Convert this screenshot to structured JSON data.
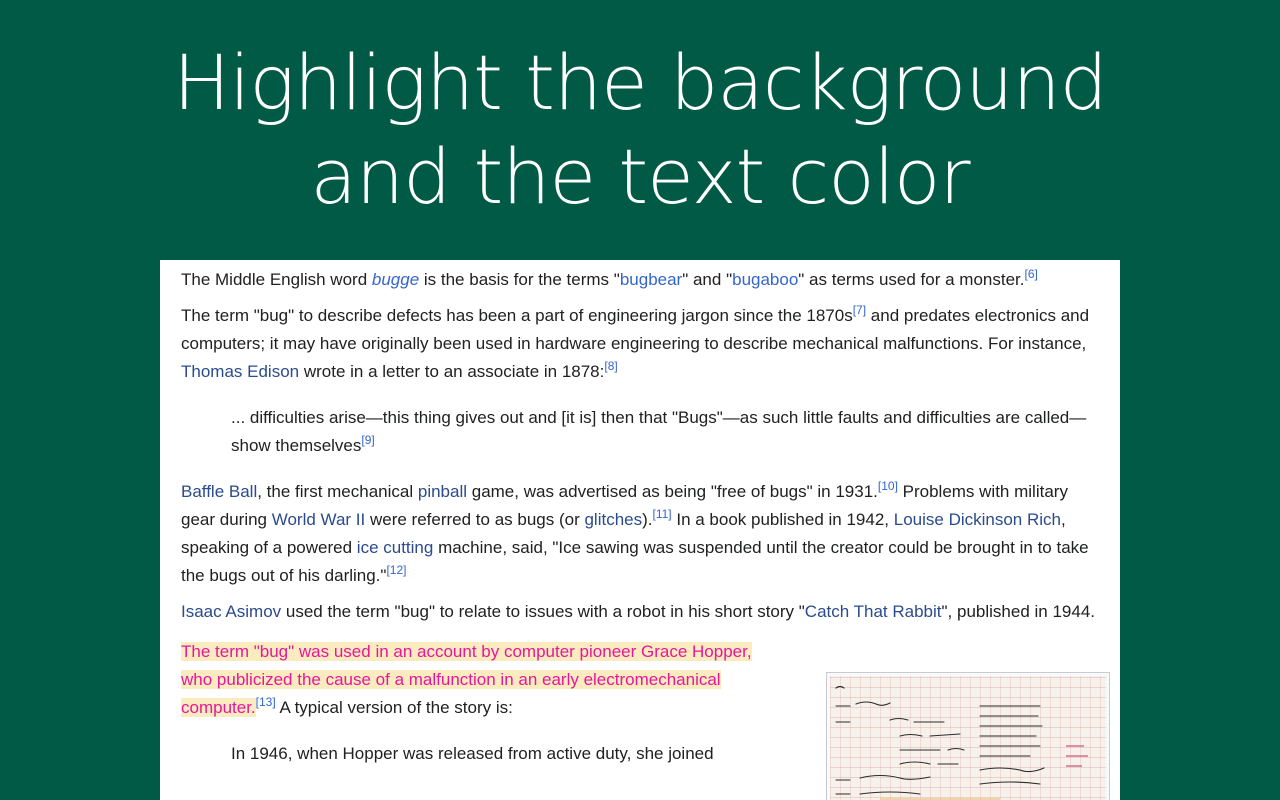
{
  "slide": {
    "title_line1": "Highlight the background",
    "title_line2": "and the text color"
  },
  "para1": {
    "t1": "The Middle English word ",
    "bugge": "bugge",
    "t2": " is the basis for the terms \"",
    "bugbear": "bugbear",
    "t3": "\" and \"",
    "bugaboo": "bugaboo",
    "t4": "\" as terms used for a monster.",
    "ref": "[6]"
  },
  "para2": {
    "t1": "The term \"bug\" to describe defects has been a part of engineering jargon since the 1870s",
    "ref1": "[7]",
    "t2": " and predates electronics and computers; it may have originally been used in hardware engineering to describe mechanical malfunctions. For instance, ",
    "edison": "Thomas Edison",
    "t3": " wrote in a letter to an associate in 1878:",
    "ref2": "[8]"
  },
  "quote1": {
    "text": "... difficulties arise—this thing gives out and [it is] then that \"Bugs\"—as such little faults and difficulties are called—show themselves",
    "ref": "[9]"
  },
  "para3": {
    "baffle": "Baffle Ball",
    "t1": ", the first mechanical ",
    "pinball": "pinball",
    "t2": " game, was advertised as being \"free of bugs\" in 1931.",
    "ref1": "[10]",
    "t3": " Problems with military gear during ",
    "ww2": "World War II",
    "t4": " were referred to as bugs (or ",
    "glitches": "glitches",
    "t5": ").",
    "ref2": "[11]",
    "t6": " In a book published in 1942, ",
    "rich": "Louise Dickinson Rich",
    "t7": ", speaking of a powered ",
    "ice": "ice cutting",
    "t8": " machine, said, \"Ice sawing was suspended until the creator could be brought in to take the bugs out of his darling.\"",
    "ref3": "[12]"
  },
  "para4": {
    "asimov": "Isaac Asimov",
    "t1": " used the term \"bug\" to relate to issues with a robot in his short story \"",
    "rabbit": "Catch That Rabbit",
    "t2": "\", published in 1944."
  },
  "para5": {
    "highlight": "The term \"bug\" was used in an account by computer pioneer Grace Hopper, who publicized the cause of a malfunction in an early electromechanical computer.",
    "ref": "[13]",
    "t1": " A typical version of the story is:"
  },
  "quote2": {
    "text": "In 1946, when Hopper was released from active duty, she joined"
  },
  "colors": {
    "slide_background": "#005a46",
    "highlight_background": "#fdebc0",
    "highlight_text": "#e5179c",
    "link": "#3366cc"
  },
  "figure": {
    "icon": "logbook-photo"
  }
}
